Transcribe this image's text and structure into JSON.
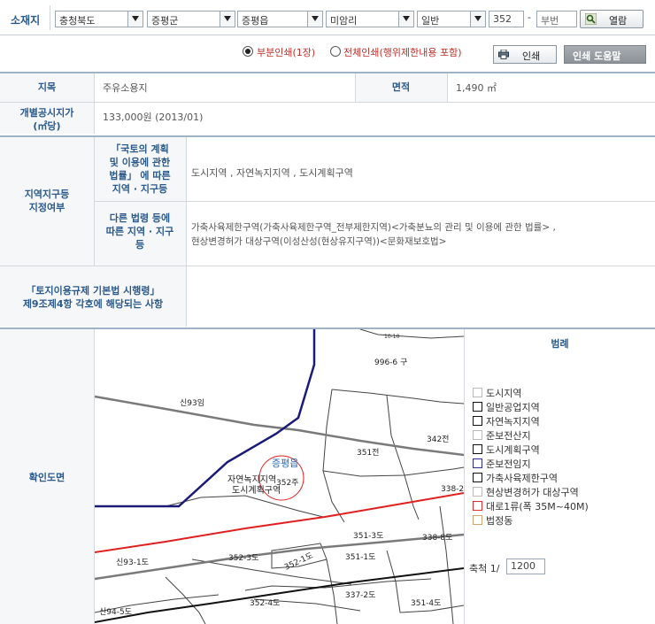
{
  "search": {
    "label": "소재지",
    "province": "충청북도",
    "county": "증평군",
    "town": "증평읍",
    "village": "미암리",
    "land_type": "일반",
    "main_lot": "352",
    "dash": "-",
    "sub_lot_placeholder": "부번",
    "view_button": "열람"
  },
  "print": {
    "option_partial": "부분인쇄(1장)",
    "option_full": "전체인쇄(행위제한내용 포함)",
    "print_button": "인쇄",
    "help_button": "인쇄 도움말"
  },
  "info": {
    "land_category_label": "지목",
    "land_category_value": "주유소용지",
    "area_label": "면적",
    "area_value": "1,490 ㎡",
    "price_label": "개별공시지가\n(㎡당)",
    "price_value": "133,000원 (2013/01)"
  },
  "zones": {
    "section_label": "지역지구등\n지정여부",
    "national_label": "「국토의 계획\n및 이용에 관한\n법률」 에 따른\n지역 · 지구등",
    "national_value": "도시지역 , 자연녹지지역 , 도시계획구역",
    "other_label": "다른 법령 등에\n따른 지역 · 지구\n등",
    "other_value_line1": "가축사육제한구역(가축사육제한구역_전부제한지역)<가축분뇨의 관리 및 이용에 관한 법률> ,",
    "other_value_line2": "현상변경허가 대상구역(이성산성(현상유지구역))<문화재보호법>"
  },
  "regulation": {
    "label": "「토지이용규제 기본법 시행령」\n제9조제4항 각호에 해당되는 사항"
  },
  "map": {
    "section_label": "확인도면",
    "parcels": [
      "996-6 구",
      "신93임",
      "342전",
      "351전",
      "338-2전",
      "351-3도",
      "338-8도",
      "352-3도",
      "352-1도",
      "351-1도",
      "신93-1도",
      "337-2도",
      "352-4도",
      "351-4도",
      "신94-5도",
      "10-10"
    ],
    "town_label": "증평읍",
    "subject_label_1": "자연녹지지역",
    "subject_label_2": "도시계획구역",
    "subject_parcel": "352주"
  },
  "legend": {
    "title": "범례",
    "items": [
      {
        "label": "도시지역",
        "color": "#bbbbbb"
      },
      {
        "label": "일반공업지역",
        "color": "#111111"
      },
      {
        "label": "자연녹지지역",
        "color": "#111111"
      },
      {
        "label": "준보전산지",
        "color": "#bbbbbb"
      },
      {
        "label": "도시계획구역",
        "color": "#111111"
      },
      {
        "label": "준보전임지",
        "color": "#2b2b8c"
      },
      {
        "label": "가축사육제한구역",
        "color": "#111111"
      },
      {
        "label": "현상변경허가 대상구역",
        "color": "#bbbbbb"
      },
      {
        "label": "대로1류(폭 35M~40M)",
        "color": "#e03030"
      },
      {
        "label": "법정동",
        "color": "#caa870"
      }
    ],
    "scale_label": "축척 1/",
    "scale_value": "1200"
  }
}
